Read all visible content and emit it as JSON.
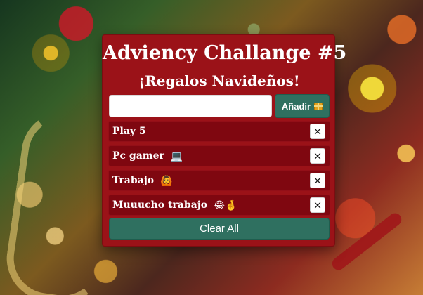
{
  "app": {
    "title": "Adviency Challange #5",
    "subtitle": "¡Regalos Navideños!"
  },
  "form": {
    "input_value": "",
    "input_placeholder": "",
    "add_button_label": "Añadir",
    "add_button_icon": "gift-icon"
  },
  "gifts": [
    {
      "label": "Play 5",
      "emoji": ""
    },
    {
      "label": "Pc gamer",
      "emoji": "💻"
    },
    {
      "label": "Trabajo",
      "emoji": "🙆"
    },
    {
      "label": "Muuucho trabajo",
      "emoji": "😂🤞"
    }
  ],
  "actions": {
    "delete_symbol": "×",
    "clear_button_label": "Clear All"
  },
  "colors": {
    "card_background": "#9b1218",
    "item_background": "#7f0710",
    "button_green": "#2f7060",
    "text_white": "#ffffff"
  }
}
